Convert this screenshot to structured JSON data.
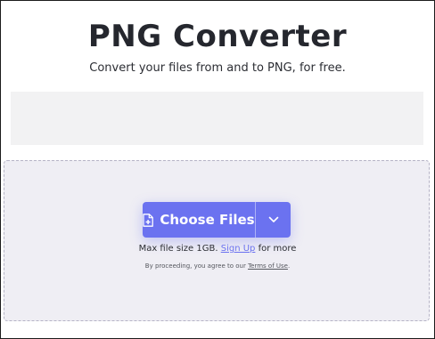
{
  "header": {
    "title": "PNG Converter",
    "subtitle": "Convert your files from and to PNG, for free."
  },
  "upload": {
    "choose_label": "Choose Files",
    "dropdown_icon": "chevron-down-icon",
    "file_icon": "file-plus-icon",
    "max_prefix": "Max file size 1GB.",
    "signup_link": "Sign Up",
    "max_suffix": "for more",
    "terms_prefix": "By proceeding, you agree to our",
    "terms_link": "Terms of Use",
    "terms_suffix": "."
  },
  "colors": {
    "accent": "#6b72f0",
    "dropzone_bg": "#efeef4",
    "title": "#25272e"
  }
}
